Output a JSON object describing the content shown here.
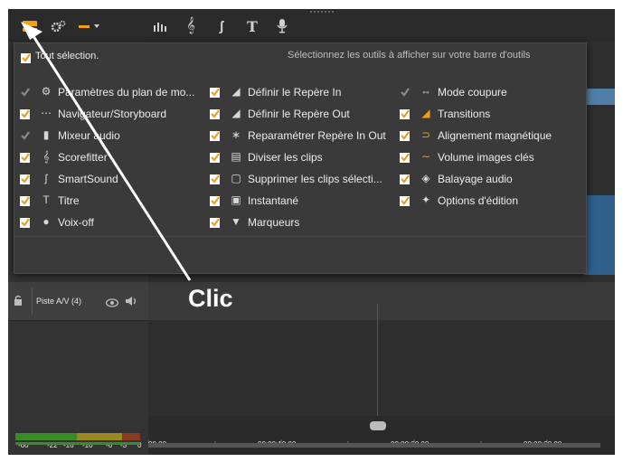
{
  "toolbar": {
    "icons": [
      "toolbar-panel-icon",
      "tool-settings-icon",
      "dropdown-toolbar-icon",
      "audio-mixer-icon",
      "scorefitter-icon",
      "smartsound-icon",
      "title-icon",
      "voiceover-icon"
    ]
  },
  "panel": {
    "select_all_label": "Tout sélection.",
    "hint": "Sélectionnez les outils à afficher sur votre barre d'outils",
    "columns": [
      [
        {
          "label": "Paramètres du plan de mo...",
          "icon": "gears-icon",
          "checked": false
        },
        {
          "label": "Navigateur/Storyboard",
          "icon": "storyboard-icon",
          "checked": true
        },
        {
          "label": "Mixeur audio",
          "icon": "audio-mixer-icon",
          "checked": false
        },
        {
          "label": "Scorefitter",
          "icon": "scorefitter-icon",
          "checked": true
        },
        {
          "label": "SmartSound",
          "icon": "smartsound-icon",
          "checked": true
        },
        {
          "label": "Titre",
          "icon": "title-icon",
          "checked": true
        },
        {
          "label": "Voix-off",
          "icon": "microphone-icon",
          "checked": true
        }
      ],
      [
        {
          "label": "Définir le Repère In",
          "icon": "mark-in-icon",
          "checked": true
        },
        {
          "label": "Définir le Repère Out",
          "icon": "mark-out-icon",
          "checked": true
        },
        {
          "label": "Reparamétrer Repère In Out",
          "icon": "reset-marks-icon",
          "checked": true
        },
        {
          "label": "Diviser les clips",
          "icon": "split-clip-icon",
          "checked": true
        },
        {
          "label": "Supprimer les clips sélecti...",
          "icon": "trash-icon",
          "checked": true
        },
        {
          "label": "Instantané",
          "icon": "camera-icon",
          "checked": true
        },
        {
          "label": "Marqueurs",
          "icon": "marker-icon",
          "checked": true
        }
      ],
      [
        {
          "label": "Mode coupure",
          "icon": "cut-mode-icon",
          "checked": false
        },
        {
          "label": "Transitions",
          "icon": "transitions-icon",
          "checked": true
        },
        {
          "label": "Alignement magnétique",
          "icon": "magnet-icon",
          "checked": true
        },
        {
          "label": "Volume images clés",
          "icon": "keyframe-volume-icon",
          "checked": true
        },
        {
          "label": "Balayage audio",
          "icon": "audio-scrub-icon",
          "checked": true
        },
        {
          "label": "Options d'édition",
          "icon": "edit-options-icon",
          "checked": true
        }
      ]
    ]
  },
  "track": {
    "name": "Piste A/V (4)"
  },
  "ruler": {
    "ticks": [
      "00.00",
      "00:00:10.00",
      "00:00:20.00",
      "00:00:30.00"
    ]
  },
  "meter": {
    "ticks": [
      "-60",
      "-22",
      "-16",
      "-10",
      "-6",
      "-3",
      "0"
    ]
  },
  "annotation": {
    "text": "Clic"
  },
  "colors": {
    "accent": "#f2a012",
    "check": "#f0a020",
    "checkbox_bg": "#ffffff",
    "panel_bg": "#3a3a3a",
    "playhead": "#cc2222"
  }
}
